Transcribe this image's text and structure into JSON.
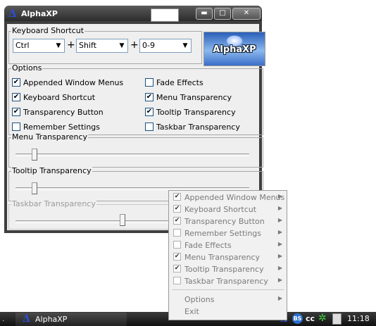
{
  "window": {
    "title": "AlphaXP",
    "app_icon": "Δ",
    "minimize_glyph": "▬",
    "maximize_glyph": "□",
    "close_glyph": "✕"
  },
  "shortcut": {
    "group_label": "Keyboard Shortcut",
    "modifier1": "Ctrl",
    "modifier2": "Shift",
    "key": "0-9",
    "plus": "+",
    "logo_text": "AlphaXP"
  },
  "options": {
    "group_label": "Options",
    "items": [
      {
        "label": "Appended Window Menus",
        "checked": true
      },
      {
        "label": "Keyboard Shortcut",
        "checked": true
      },
      {
        "label": "Transparency Button",
        "checked": true
      },
      {
        "label": "Remember Settings",
        "checked": false
      },
      {
        "label": "Fade Effects",
        "checked": false
      },
      {
        "label": "Menu Transparency",
        "checked": true
      },
      {
        "label": "Tooltip Transparency",
        "checked": true
      },
      {
        "label": "Taskbar Transparency",
        "checked": false
      }
    ]
  },
  "sliders": {
    "menu": {
      "label": "Menu Transparency",
      "value_fraction": 0.08
    },
    "tooltip": {
      "label": "Tooltip Transparency",
      "value_fraction": 0.08
    },
    "taskbar": {
      "label": "Taskbar Transparency",
      "value_fraction": 0.45,
      "enabled": false
    }
  },
  "context_menu": {
    "items": [
      {
        "label": "Appended Window Menus",
        "checked": true
      },
      {
        "label": "Keyboard Shortcut",
        "checked": true
      },
      {
        "label": "Transparency Button",
        "checked": true
      },
      {
        "label": "Remember Settings",
        "checked": false
      },
      {
        "label": "Fade Effects",
        "checked": false
      },
      {
        "label": "Menu Transparency",
        "checked": true
      },
      {
        "label": "Tooltip Transparency",
        "checked": true
      },
      {
        "label": "Taskbar Transparency",
        "checked": false
      }
    ],
    "options_label": "Options",
    "exit_label": "Exit",
    "submenu_arrow": "▶"
  },
  "taskbar": {
    "start_text": ".",
    "task_label": "AlphaXP",
    "clock": "11:18",
    "tray_bs": "BS",
    "tray_cc": "cc",
    "tray_chevron": "‹"
  },
  "colors": {
    "check": "✔",
    "accent": "#2b4fd6"
  }
}
